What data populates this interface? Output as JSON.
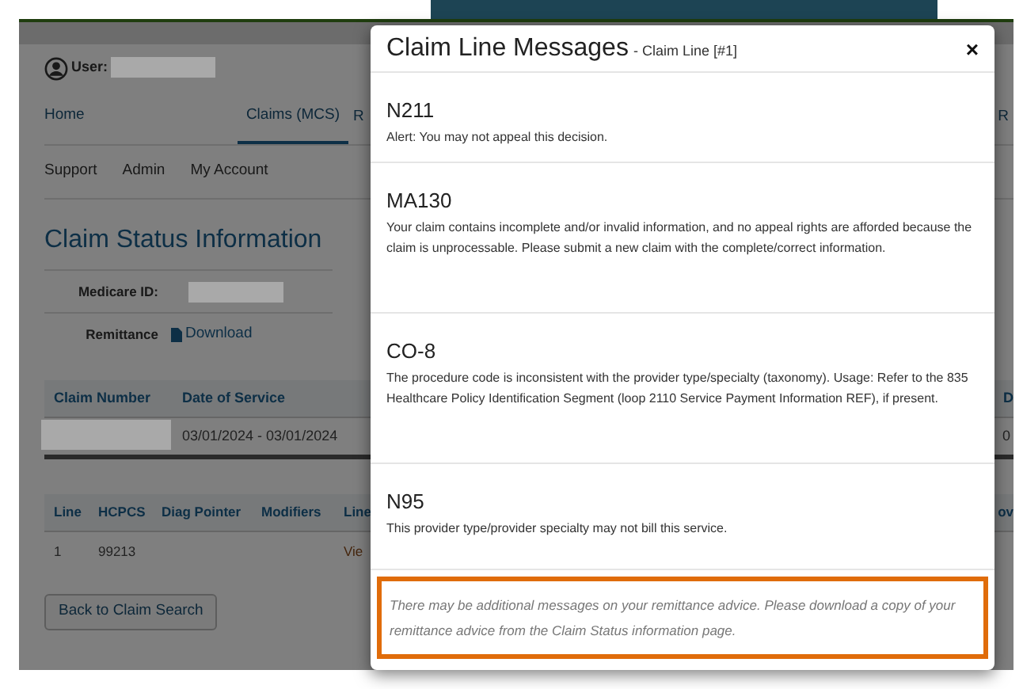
{
  "user": {
    "label": "User:"
  },
  "nav_tabs": [
    {
      "label": "Home",
      "selected": false
    },
    {
      "label": "Claims (MCS)",
      "selected": true
    }
  ],
  "nav_fragment": "R",
  "nav_right_fragment": "R",
  "sub_nav": [
    "Support",
    "Admin",
    "My Account"
  ],
  "page_title": "Claim Status Information",
  "details": [
    {
      "label": "Medicare ID:",
      "kind": "redacted"
    },
    {
      "label": "Remittance",
      "kind": "link",
      "value": "Download"
    }
  ],
  "claims_table": {
    "columns": [
      "Claim Number",
      "Date of Service"
    ],
    "column_fragment": "D",
    "rows": [
      {
        "date_of_service": "03/01/2024 - 03/01/2024",
        "fragment": "0"
      }
    ]
  },
  "lines_table": {
    "columns": [
      "Line",
      "HCPCS",
      "Diag Pointer",
      "Modifiers",
      "Line"
    ],
    "column_fragment": "ov",
    "rows": [
      {
        "line": "1",
        "hcpcs": "99213",
        "column_5": "Vie"
      }
    ]
  },
  "back_button": "Back to Claim Search",
  "modal": {
    "title": "Claim Line Messages",
    "subtitle": "- Claim Line [#1]",
    "close": "×",
    "messages": [
      {
        "code": "N211",
        "text": "Alert: You may not appeal this decision."
      },
      {
        "code": "MA130",
        "text": "Your claim contains incomplete and/or invalid information, and no appeal rights are afforded because the claim is unprocessable. Please submit a new claim with the complete/correct information."
      },
      {
        "code": "CO-8",
        "text": "The procedure code is inconsistent with the provider type/specialty (taxonomy). Usage: Refer to the 835 Healthcare Policy Identification Segment (loop 2110 Service Payment Information REF), if present."
      },
      {
        "code": "N95",
        "text": "This provider type/provider specialty may not bill this service."
      }
    ],
    "notice": "There may be additional messages on your remittance advice. Please download a copy of your remittance advice from the Claim Status information page."
  }
}
